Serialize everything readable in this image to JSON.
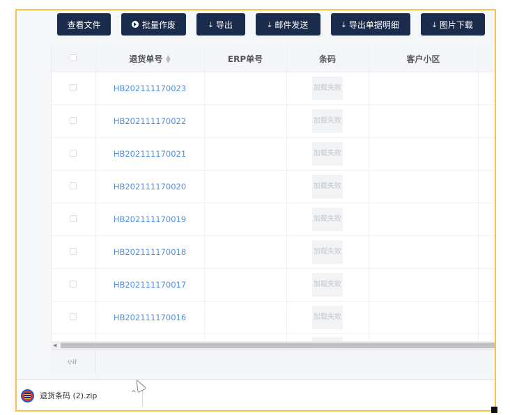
{
  "toolbar": {
    "buttons": [
      {
        "label": "查看文件"
      },
      {
        "label": "批量作废"
      },
      {
        "label": "导出"
      },
      {
        "label": "邮件发送"
      },
      {
        "label": "导出单据明细"
      },
      {
        "label": "图片下载"
      }
    ]
  },
  "table": {
    "headers": [
      "退货单号",
      "ERP单号",
      "条码",
      "客户小区"
    ],
    "image_failed_text": "加载失败",
    "rows": [
      {
        "return_no": "HB202111170023",
        "erp_no": "",
        "customer_area": ""
      },
      {
        "return_no": "HB202111170022",
        "erp_no": "",
        "customer_area": ""
      },
      {
        "return_no": "HB202111170021",
        "erp_no": "",
        "customer_area": ""
      },
      {
        "return_no": "HB202111170020",
        "erp_no": "",
        "customer_area": ""
      },
      {
        "return_no": "HB202111170019",
        "erp_no": "",
        "customer_area": ""
      },
      {
        "return_no": "HB202111170018",
        "erp_no": "",
        "customer_area": ""
      },
      {
        "return_no": "HB202111170017",
        "erp_no": "",
        "customer_area": ""
      },
      {
        "return_no": "HB202111170016",
        "erp_no": "",
        "customer_area": ""
      }
    ],
    "summary_label": "小计"
  },
  "download_bar": {
    "file_name": "退货条码 (2).zip"
  },
  "colors": {
    "button_bg": "#1a2b4c",
    "link": "#4d8fe6",
    "frame_border": "#f5c34a"
  }
}
